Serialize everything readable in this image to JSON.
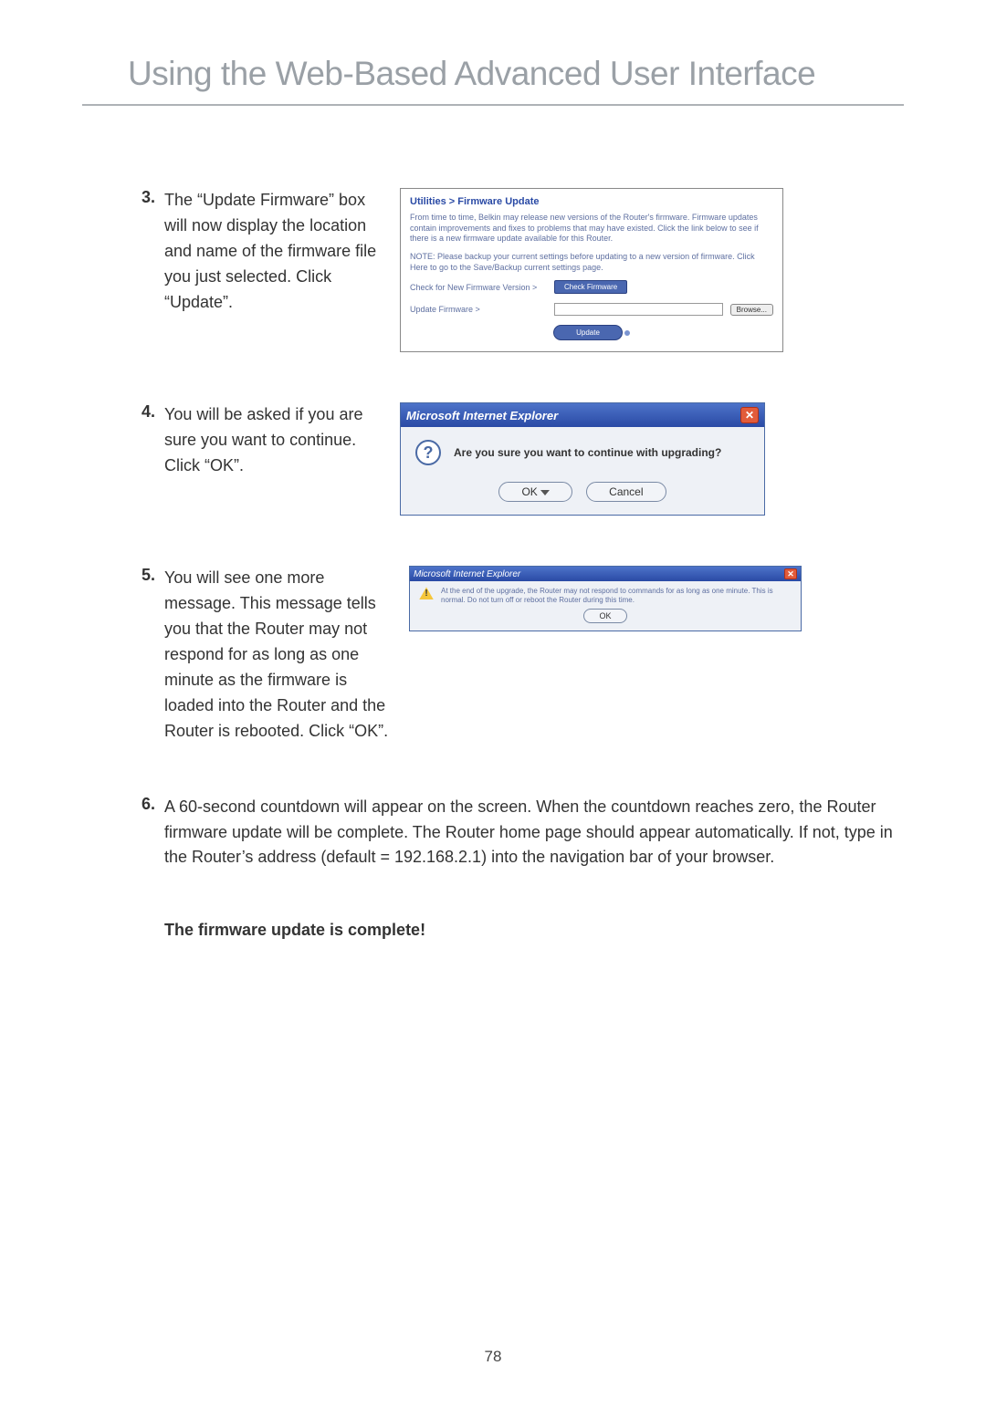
{
  "page_title": "Using the Web-Based Advanced User Interface",
  "page_number": "78",
  "steps": [
    {
      "num": "3.",
      "text": "The “Update Firmware” box will now display the location and name of the firmware file you just selected. Click “Update”."
    },
    {
      "num": "4.",
      "text": "You will be asked if you are sure you want to continue. Click “OK”."
    },
    {
      "num": "5.",
      "text": "You will see one more message. This message tells you that the Router may not respond for as long as one minute as the firmware is loaded into the Router and the Router is rebooted. Click “OK”."
    },
    {
      "num": "6.",
      "text": "A 60-second countdown will appear on the screen. When the countdown reaches zero, the Router firmware update will be complete. The Router home page should appear automatically. If not, type in the Router’s address (default = 192.168.2.1) into the navigation bar of your browser."
    }
  ],
  "complete_text": "The firmware update is complete!",
  "fw_panel": {
    "breadcrumb": "Utilities > Firmware Update",
    "intro": "From time to time, Belkin may release new versions of the Router's firmware. Firmware updates contain improvements and fixes to problems that may have existed. Click the link below to see if there is a new firmware update available for this Router.",
    "note": "NOTE: Please backup your current settings before updating to a new version of firmware. Click Here to go to the Save/Backup current settings page.",
    "check_label": "Check for New Firmware Version >",
    "check_btn": "Check Firmware",
    "update_label": "Update Firmware >",
    "browse_btn": "Browse...",
    "update_btn": "Update"
  },
  "dlg1": {
    "title": "Microsoft Internet Explorer",
    "message": "Are you sure you want to continue with upgrading?",
    "ok": "OK",
    "cancel": "Cancel"
  },
  "dlg2": {
    "title": "Microsoft Internet Explorer",
    "message": "At the end of the upgrade, the Router may not respond to commands for as long as one minute. This is normal. Do not turn off or reboot the Router during this time.",
    "ok": "OK"
  }
}
